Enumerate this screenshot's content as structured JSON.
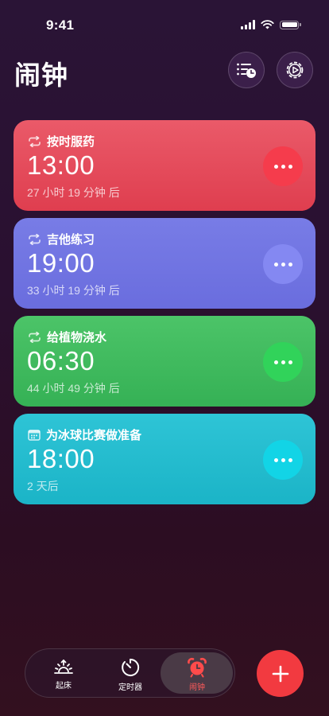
{
  "status_bar": {
    "time": "9:41"
  },
  "header": {
    "title": "闹钟",
    "list_icon": "list-clock-icon",
    "settings_icon": "gear-play-icon"
  },
  "alarms": [
    {
      "name": "按时服药",
      "time": "13:00",
      "remaining": "27 小时 19 分钟 后",
      "repeat_icon": "repeat-icon",
      "color": "#e8505f"
    },
    {
      "name": "吉他练习",
      "time": "19:00",
      "remaining": "33 小时 19 分钟 后",
      "repeat_icon": "repeat-icon",
      "color": "#6f73e0"
    },
    {
      "name": "给植物浇水",
      "time": "06:30",
      "remaining": "44 小时 49 分钟 后",
      "repeat_icon": "repeat-icon",
      "color": "#3fbb5f"
    },
    {
      "name": "为冰球比赛做准备",
      "time": "18:00",
      "remaining": "2 天后",
      "repeat_icon": "calendar-icon",
      "color": "#22bccf"
    }
  ],
  "tabs": [
    {
      "label": "起床",
      "icon": "sunrise-icon",
      "active": false
    },
    {
      "label": "定时器",
      "icon": "timer-icon",
      "active": false
    },
    {
      "label": "闹钟",
      "icon": "alarm-clock-icon",
      "active": true
    }
  ],
  "fab": {
    "icon": "plus-icon"
  },
  "colors": {
    "accent": "#f23a40",
    "tab_active": "#ff4b4b"
  }
}
